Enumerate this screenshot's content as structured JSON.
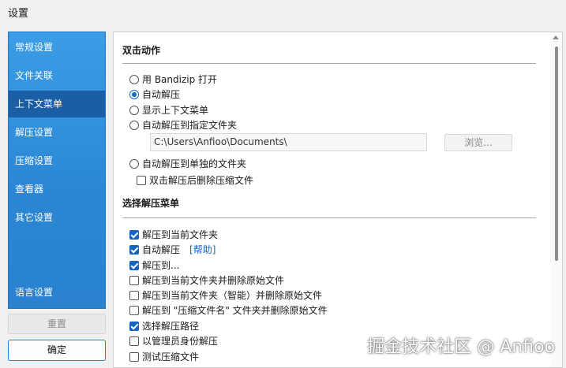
{
  "window": {
    "title": "设置"
  },
  "sidebar": {
    "items": [
      {
        "label": "常规设置",
        "active": false
      },
      {
        "label": "文件关联",
        "active": false
      },
      {
        "label": "上下文菜单",
        "active": true
      },
      {
        "label": "解压设置",
        "active": false
      },
      {
        "label": "压缩设置",
        "active": false
      },
      {
        "label": "查看器",
        "active": false
      },
      {
        "label": "其它设置",
        "active": false
      }
    ],
    "language": "语言设置",
    "reset_label": "重置",
    "ok_label": "确定"
  },
  "double_click": {
    "title": "双击动作",
    "options": [
      {
        "label": "用 Bandizip 打开",
        "selected": false
      },
      {
        "label": "自动解压",
        "selected": true
      },
      {
        "label": "显示上下文菜单",
        "selected": false
      },
      {
        "label": "自动解压到指定文件夹",
        "selected": false
      }
    ],
    "path_value": "C:\\Users\\Anfioo\\Documents\\",
    "browse_label": "浏览...",
    "option_separate": {
      "label": "自动解压到单独的文件夹",
      "selected": false
    },
    "delete_after": {
      "label": "双击解压后删除压缩文件",
      "checked": false
    }
  },
  "extract_menu": {
    "title": "选择解压菜单",
    "items": [
      {
        "label": "解压到当前文件夹",
        "checked": true
      },
      {
        "label": "自动解压",
        "checked": true,
        "link": "[帮助]"
      },
      {
        "label": "解压到...",
        "checked": true
      },
      {
        "label": "解压到当前文件夹并删除原始文件",
        "checked": false
      },
      {
        "label": "解压到当前文件夹（智能）并删除原始文件",
        "checked": false
      },
      {
        "label": "解压到 \"压缩文件名\" 文件夹并删除原始文件",
        "checked": false
      },
      {
        "label": "选择解压路径",
        "checked": true
      },
      {
        "label": "以管理员身份解压",
        "checked": false
      },
      {
        "label": "测试压缩文件",
        "checked": false
      }
    ]
  },
  "watermark": "掘金技术社区 @ Anfioo",
  "colors": {
    "accent": "#1565c0",
    "sidebar": "#2a86d4",
    "sidebar_active": "#1a5fa5"
  }
}
